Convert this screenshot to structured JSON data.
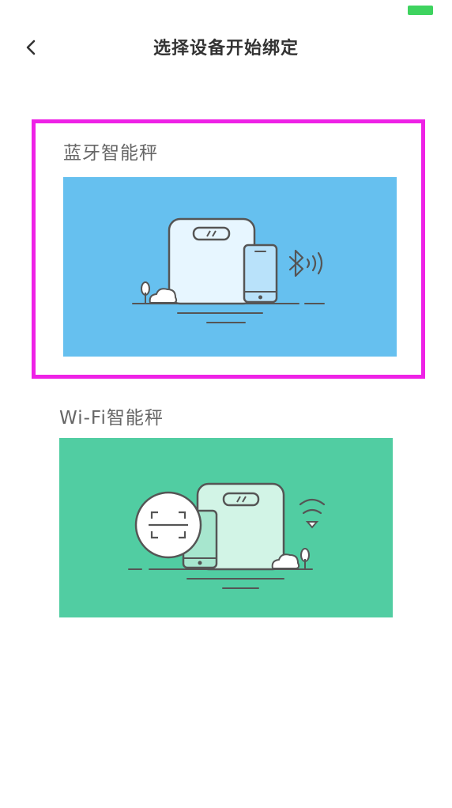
{
  "status_bar": {
    "battery_color": "#3ed35f"
  },
  "header": {
    "back_icon": "chevron-left-icon",
    "title": "选择设备开始绑定"
  },
  "devices": [
    {
      "label": "蓝牙智能秤",
      "selected": true,
      "image_bg": "#66c0ef",
      "icons": [
        "scale-icon",
        "phone-icon",
        "bluetooth-icon",
        "tree-icon",
        "cloud-icon"
      ]
    },
    {
      "label": "Wi-Fi智能秤",
      "selected": false,
      "image_bg": "#51cda2",
      "icons": [
        "scan-icon",
        "phone-icon",
        "scale-icon",
        "wifi-icon",
        "tree-icon",
        "cloud-icon"
      ]
    }
  ],
  "colors": {
    "highlight": "#ee22e6",
    "title": "#333333",
    "label": "#666666"
  }
}
